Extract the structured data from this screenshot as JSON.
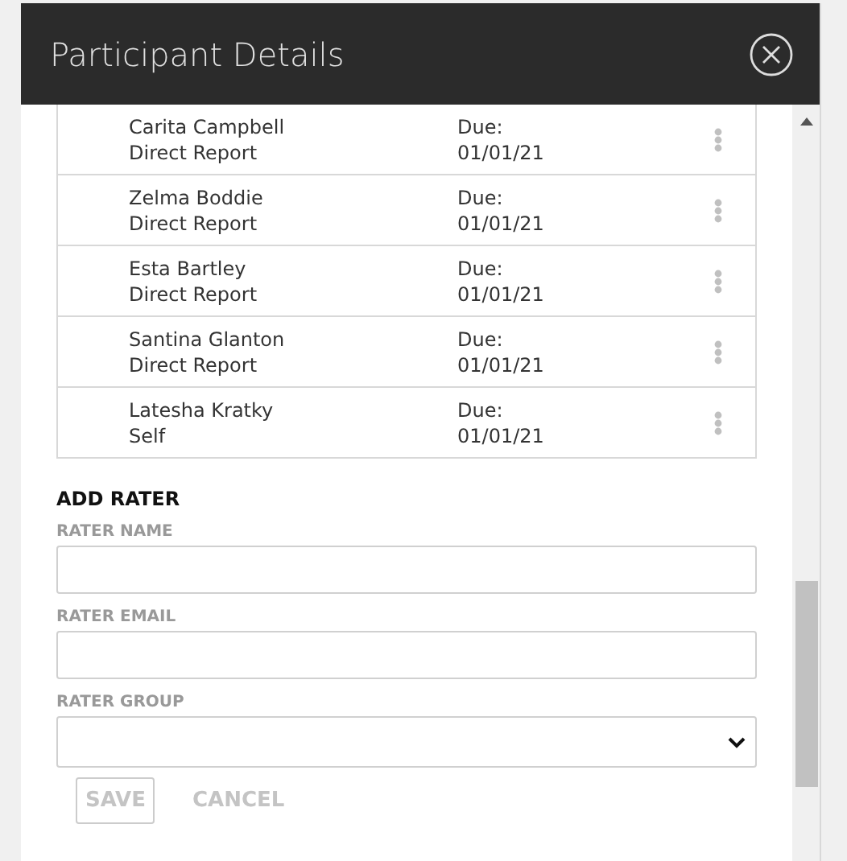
{
  "dialog": {
    "title": "Participant Details"
  },
  "raters": [
    {
      "name": "Carita Campbell",
      "group": "Direct Report",
      "due_label": "Due:",
      "due_date": "01/01/21"
    },
    {
      "name": "Zelma Boddie",
      "group": "Direct Report",
      "due_label": "Due:",
      "due_date": "01/01/21"
    },
    {
      "name": "Esta Bartley",
      "group": "Direct Report",
      "due_label": "Due:",
      "due_date": "01/01/21"
    },
    {
      "name": "Santina Glanton",
      "group": "Direct Report",
      "due_label": "Due:",
      "due_date": "01/01/21"
    },
    {
      "name": "Latesha Kratky",
      "group": "Self",
      "due_label": "Due:",
      "due_date": "01/01/21"
    }
  ],
  "add_rater": {
    "heading": "ADD RATER",
    "fields": [
      {
        "kind": "text",
        "label": "RATER NAME"
      },
      {
        "kind": "text",
        "label": "RATER EMAIL"
      },
      {
        "kind": "select",
        "label": "RATER GROUP"
      }
    ],
    "buttons": [
      {
        "kind": "outlined",
        "label": "SAVE",
        "disabled": true
      },
      {
        "kind": "plain",
        "label": "CANCEL",
        "disabled": true
      }
    ]
  }
}
